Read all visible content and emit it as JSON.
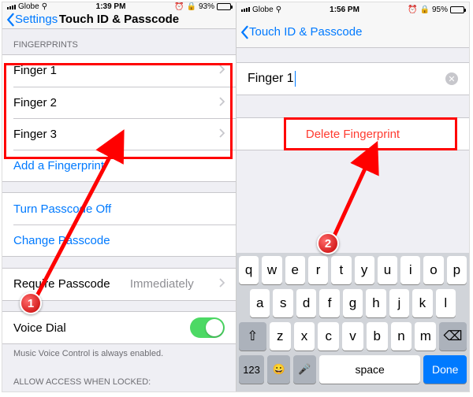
{
  "left": {
    "status": {
      "carrier": "Globe",
      "time": "1:39 PM",
      "alarm": "⏰",
      "battery": "93%"
    },
    "nav": {
      "back": "Settings",
      "title": "Touch ID & Passcode"
    },
    "fingerprints_header": "FINGERPRINTS",
    "fingerprints": [
      "Finger 1",
      "Finger 2",
      "Finger 3"
    ],
    "add_fingerprint": "Add a Fingerprint",
    "turn_off": "Turn Passcode Off",
    "change": "Change Passcode",
    "require_label": "Require Passcode",
    "require_value": "Immediately",
    "voice_dial": "Voice Dial",
    "voice_footer": "Music Voice Control is always enabled.",
    "allow_header": "ALLOW ACCESS WHEN LOCKED:"
  },
  "right": {
    "status": {
      "carrier": "Globe",
      "time": "1:56 PM",
      "alarm": "⏰",
      "battery": "95%"
    },
    "nav": {
      "back": "Touch ID & Passcode"
    },
    "input_value": "Finger 1",
    "delete": "Delete Fingerprint",
    "keyboard": {
      "row1": [
        "q",
        "w",
        "e",
        "r",
        "t",
        "y",
        "u",
        "i",
        "o",
        "p"
      ],
      "row2": [
        "a",
        "s",
        "d",
        "f",
        "g",
        "h",
        "j",
        "k",
        "l"
      ],
      "row3": [
        "z",
        "x",
        "c",
        "v",
        "b",
        "n",
        "m"
      ],
      "shift": "⇧",
      "backspace": "⌫",
      "numbers": "123",
      "emoji": "😀",
      "mic": "🎤",
      "space": "space",
      "done": "Done"
    }
  },
  "annotations": {
    "step1": "1",
    "step2": "2"
  }
}
